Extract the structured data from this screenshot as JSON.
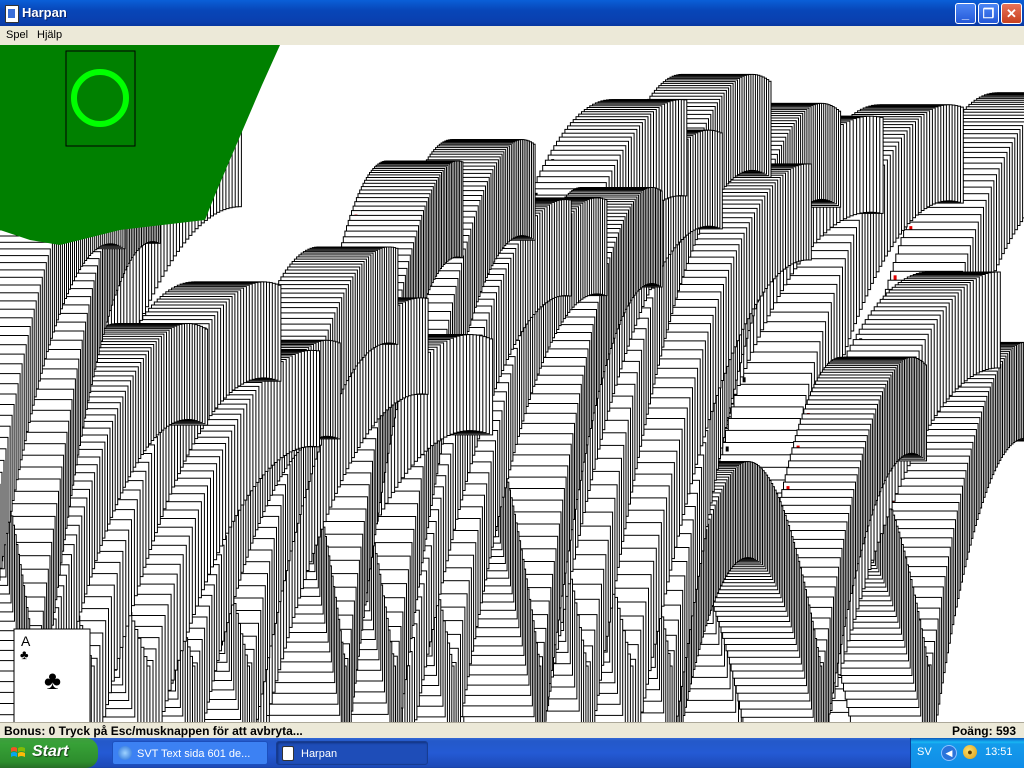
{
  "window": {
    "title": "Harpan",
    "controls": {
      "minimize": "_",
      "maximize": "❐",
      "close": "✕"
    }
  },
  "menu": {
    "items": [
      {
        "label": "Spel"
      },
      {
        "label": "Hjälp"
      }
    ]
  },
  "game": {
    "stock_icon": "circle-restart-icon",
    "felt_color": "#008000",
    "circle_color": "#00ff00",
    "visible_card": {
      "rank": "A",
      "suit": "♣"
    }
  },
  "status": {
    "message": "Bonus: 0  Tryck på Esc/musknappen för att avbryta...",
    "score": "Poäng: 593"
  },
  "taskbar": {
    "start_label": "Start",
    "tasks": [
      {
        "label": "SVT Text sida 601 de...",
        "icon": "internet-explorer-icon"
      },
      {
        "label": "Harpan",
        "icon": "harpan-app-icon"
      }
    ],
    "tray": {
      "language": "SV",
      "time": "13:51"
    }
  }
}
